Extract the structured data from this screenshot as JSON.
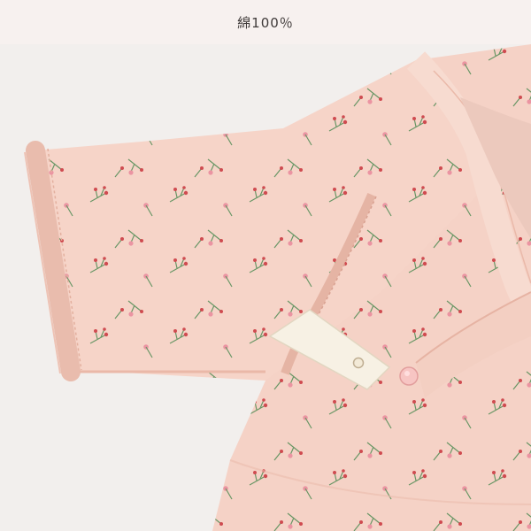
{
  "header": {
    "label": "綿100％"
  },
  "photo": {
    "subject": "baby-garment-photo"
  }
}
